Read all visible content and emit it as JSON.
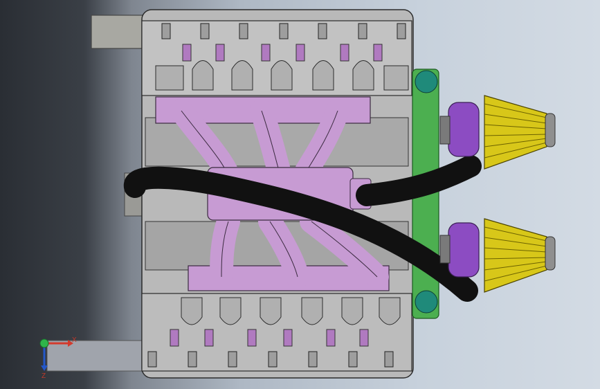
{
  "viewport": {
    "kind": "cad-3d-view",
    "model_subject": "engine-assembly-top-view",
    "background_colors": [
      "#2a2e34",
      "#aeb8c4",
      "#d3dbe4"
    ]
  },
  "colors": {
    "engine_block": "#b9b9b9",
    "edges": "#2b2b2b",
    "intake_manifold": "#c79bd3",
    "hose": "#111111",
    "throttle_body": "#8c4cc2",
    "air_filter": "#d8c719",
    "belt_drive": "#4caf50",
    "pulley": "#1f8a7a"
  },
  "triad": {
    "x_label": "X",
    "z_label": "Z",
    "x_color": "#d33a2c",
    "y_color": "#2fb54a",
    "z_color": "#2457c8"
  }
}
